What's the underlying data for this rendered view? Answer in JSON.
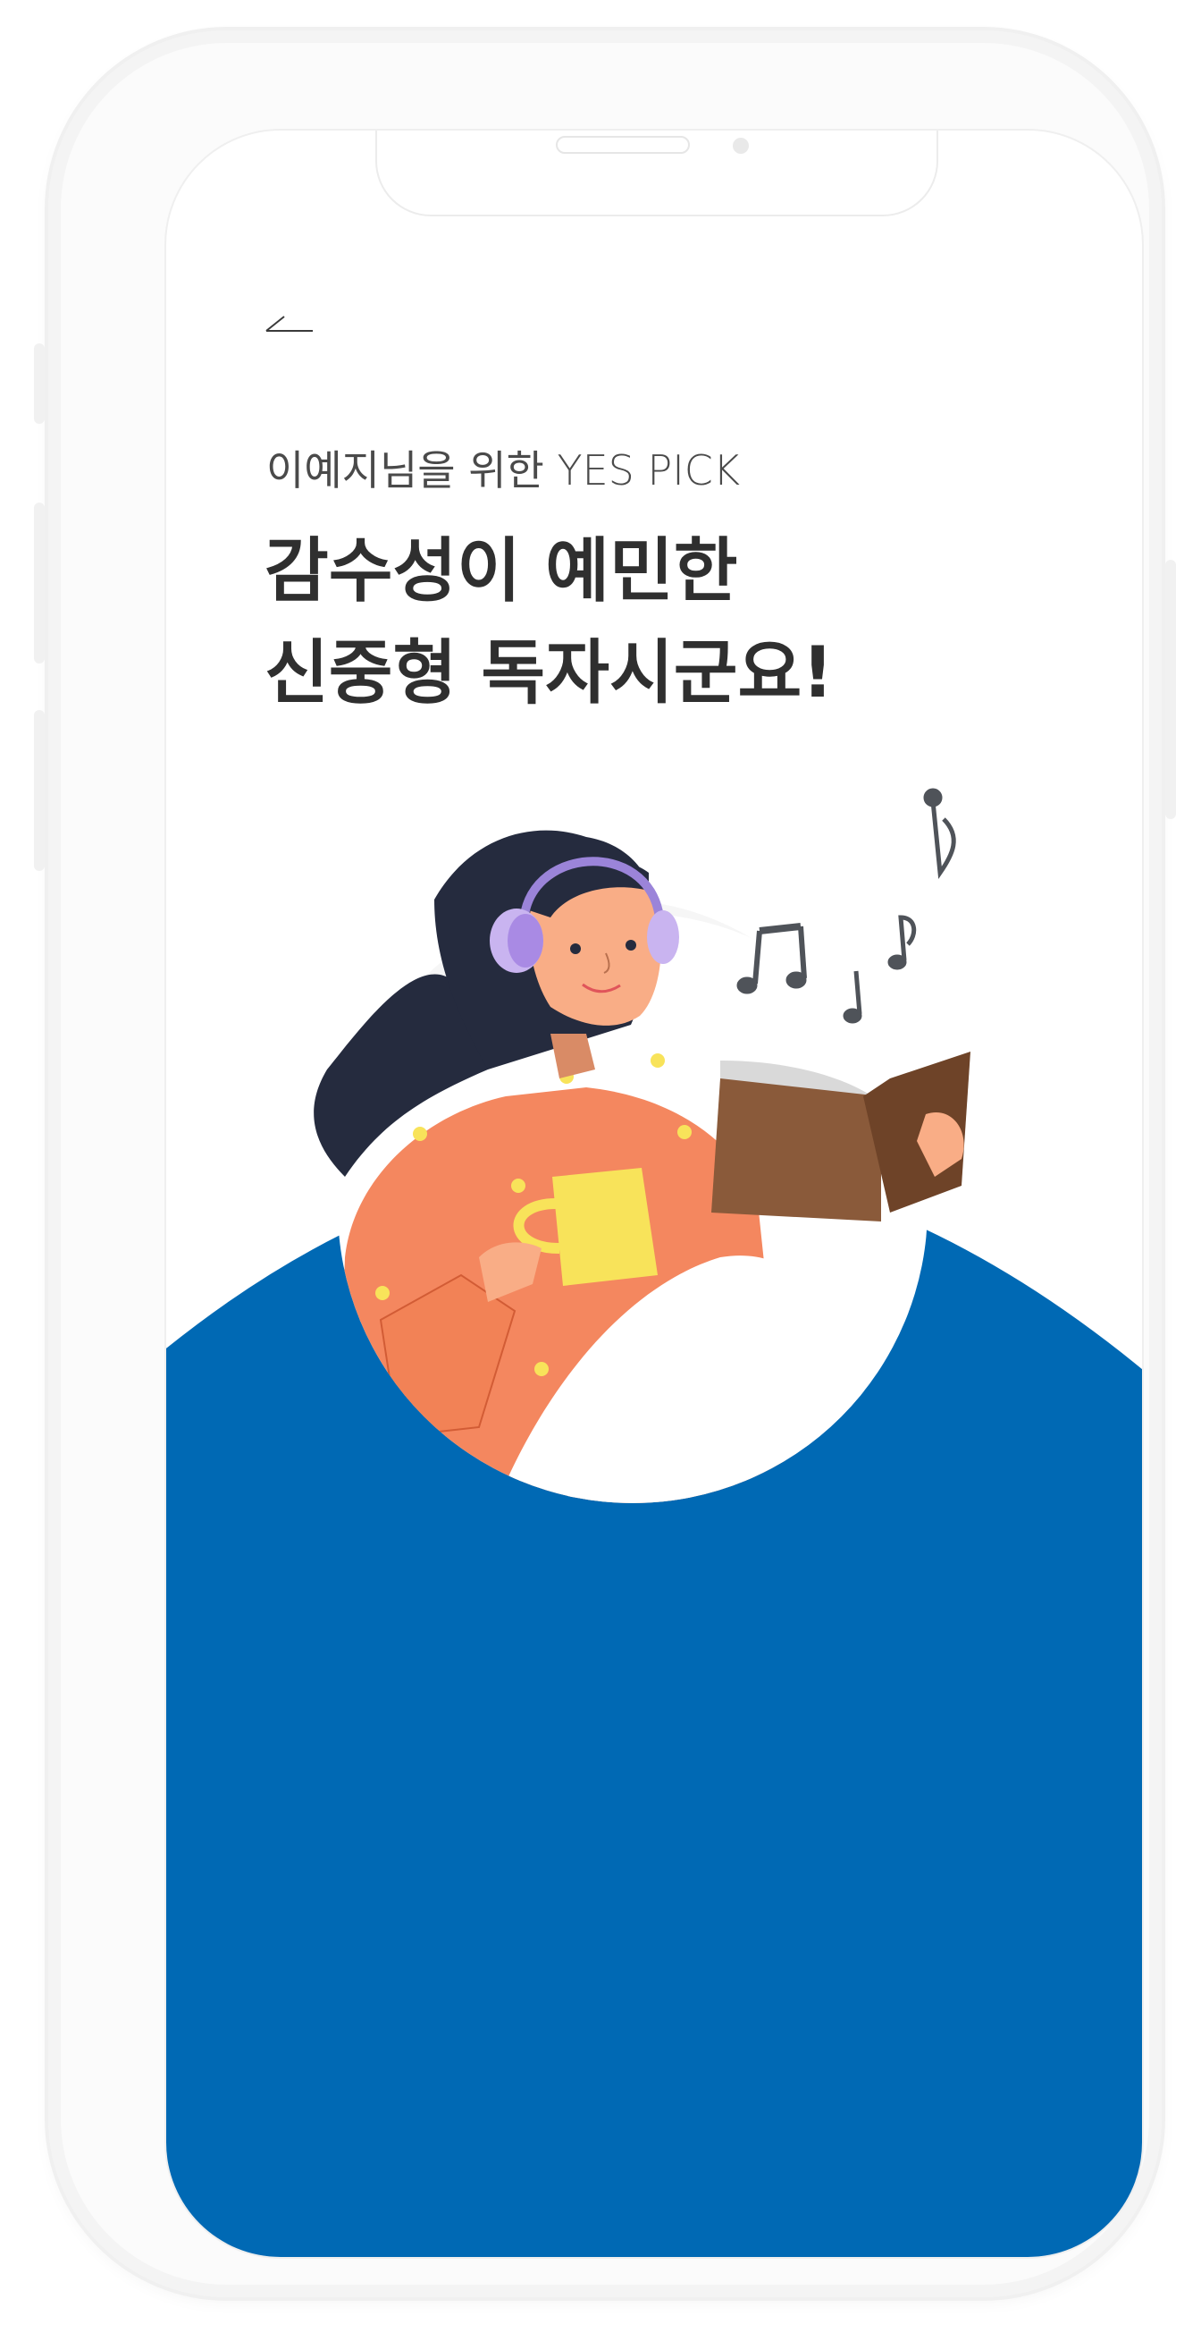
{
  "header": {
    "back_icon": "back-arrow-icon"
  },
  "pick": {
    "subtitle": "이예지님을 위한 YES PICK",
    "headline_line1": "감수성이 예민한",
    "headline_line2": "신중형 독자시군요!"
  },
  "illustration": {
    "icon": "woman-reading-with-headphones-illustration",
    "notes_icon": "music-notes-icon"
  },
  "colors": {
    "primary_blue": "#0069b4",
    "headline_text": "#2f2f2f",
    "subtitle_text": "#4a4a4a",
    "sweater": "#f4875f",
    "hair": "#252b3e",
    "headphones": "#c9b4f0",
    "mug": "#f8e35a",
    "book": "#8a5a3a"
  }
}
